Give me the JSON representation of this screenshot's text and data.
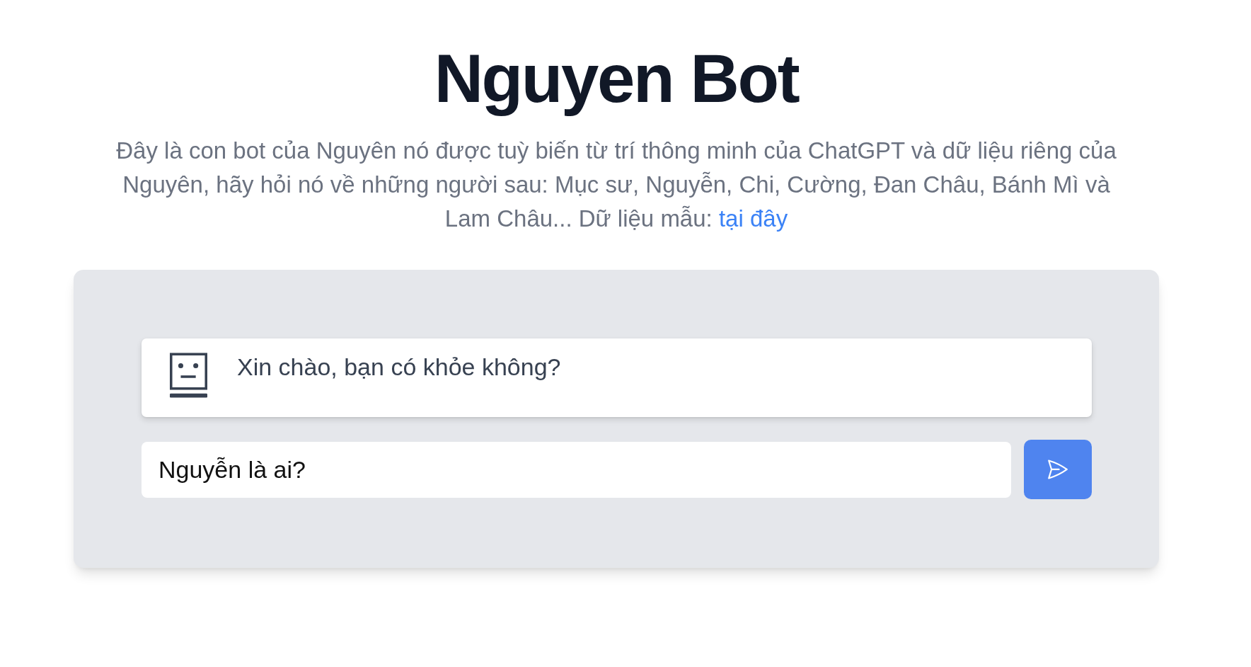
{
  "header": {
    "title": "Nguyen Bot",
    "description": "Đây là con bot của Nguyên nó được tuỳ biến từ trí thông minh của ChatGPT và dữ liệu riêng của Nguyên, hãy hỏi nó về những người sau: Mục sư, Nguyễn, Chi, Cường, Đan Châu, Bánh Mì và Lam Châu... Dữ liệu mẫu:",
    "link": "tại đây"
  },
  "chat": {
    "messages": [
      {
        "kind": "bot",
        "text": "Xin chào, bạn có khỏe không?"
      }
    ],
    "input": {
      "value": "Nguyễn là ai?"
    }
  }
}
